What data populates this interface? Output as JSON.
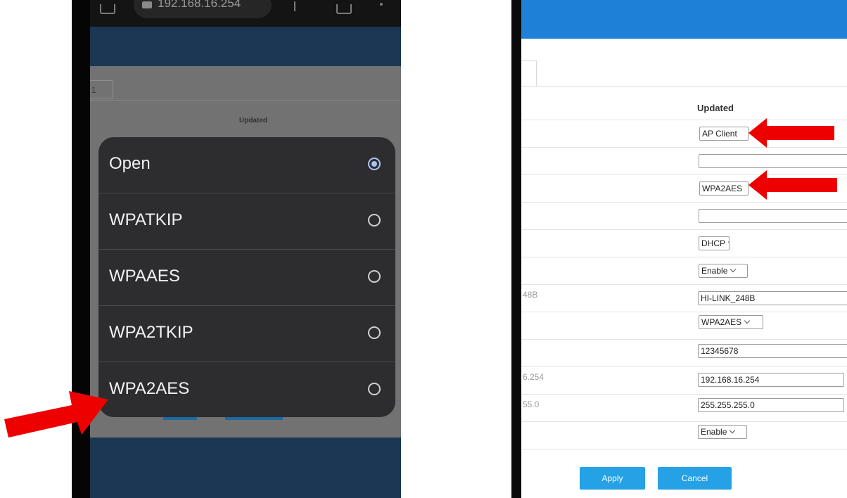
{
  "phone": {
    "url_text": "192.168.16.254",
    "page_tab_label": "1",
    "updated_label": "Updated",
    "options": [
      {
        "label": "Open",
        "selected": true
      },
      {
        "label": "WPATKIP",
        "selected": false
      },
      {
        "label": "WPAAES",
        "selected": false
      },
      {
        "label": "WPA2TKIP",
        "selected": false
      },
      {
        "label": "WPA2AES",
        "selected": false
      }
    ]
  },
  "router": {
    "column_header": "Updated",
    "rows": [
      {
        "left": "",
        "value": "AP Client",
        "kind": "select"
      },
      {
        "left": "",
        "value": "",
        "kind": "input"
      },
      {
        "left": "",
        "value": "WPA2AES",
        "kind": "select"
      },
      {
        "left": "",
        "value": "",
        "kind": "input"
      },
      {
        "left": "",
        "value": "DHCP",
        "kind": "select"
      },
      {
        "left": "",
        "value": "Enable",
        "kind": "select"
      },
      {
        "left": "48B",
        "value": "HI-LINK_248B",
        "kind": "input"
      },
      {
        "left": "",
        "value": "WPA2AES",
        "kind": "select"
      },
      {
        "left": "",
        "value": "12345678",
        "kind": "input"
      },
      {
        "left": "6.254",
        "value": "192.168.16.254",
        "kind": "input"
      },
      {
        "left": "55.0",
        "value": "255.255.255.0",
        "kind": "input"
      },
      {
        "left": "",
        "value": "Enable",
        "kind": "select"
      }
    ],
    "apply_label": "Apply",
    "cancel_label": "Cancel"
  },
  "colors": {
    "arrow": "#ee0000",
    "router_header": "#1e80d6",
    "router_button": "#25a1e6",
    "phone_banner": "#1b3754",
    "dialog_bg": "#2d2d30",
    "radio_selected": "#a9c4f4"
  }
}
